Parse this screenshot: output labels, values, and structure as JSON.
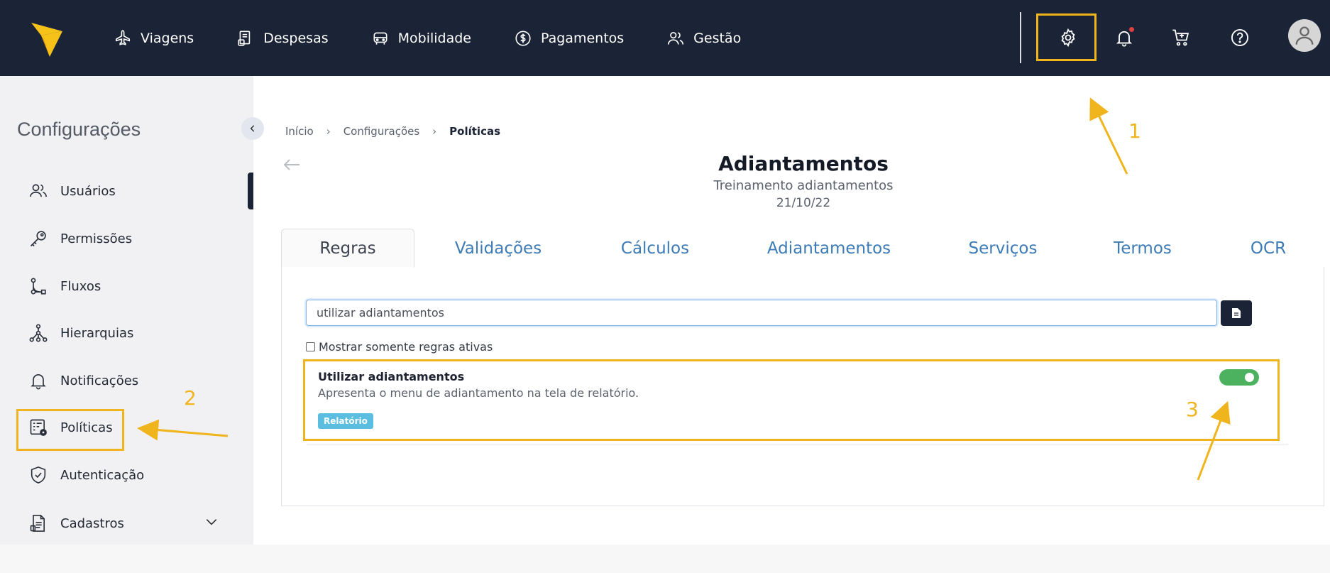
{
  "topbar": {
    "nav": [
      {
        "label": "Viagens",
        "icon": "airplane-icon"
      },
      {
        "label": "Despesas",
        "icon": "receipt-icon"
      },
      {
        "label": "Mobilidade",
        "icon": "car-icon"
      },
      {
        "label": "Pagamentos",
        "icon": "dollar-circle-icon"
      },
      {
        "label": "Gestão",
        "icon": "users-icon"
      }
    ],
    "icons": [
      "gear-icon",
      "bell-icon",
      "cart-icon",
      "help-icon",
      "user-avatar-icon"
    ]
  },
  "sidebar": {
    "title": "Configurações",
    "items": [
      {
        "label": "Usuários",
        "icon": "users-icon"
      },
      {
        "label": "Permissões",
        "icon": "key-icon"
      },
      {
        "label": "Fluxos",
        "icon": "flow-icon"
      },
      {
        "label": "Hierarquias",
        "icon": "hierarchy-icon"
      },
      {
        "label": "Notificações",
        "icon": "bell-icon"
      },
      {
        "label": "Políticas",
        "icon": "policy-gear-icon"
      },
      {
        "label": "Autenticação",
        "icon": "shield-check-icon"
      },
      {
        "label": "Cadastros",
        "icon": "document-list-icon"
      }
    ]
  },
  "breadcrumb": {
    "items": [
      "Início",
      "Configurações"
    ],
    "current": "Políticas"
  },
  "header": {
    "title": "Adiantamentos",
    "subtitle": "Treinamento adiantamentos",
    "date": "21/10/22"
  },
  "tabs": [
    {
      "label": "Regras",
      "active": true
    },
    {
      "label": "Validações"
    },
    {
      "label": "Cálculos"
    },
    {
      "label": "Adiantamentos"
    },
    {
      "label": "Serviços"
    },
    {
      "label": "Termos"
    },
    {
      "label": "OCR"
    }
  ],
  "search": {
    "value": "utilizar adiantamentos"
  },
  "filter": {
    "label": "Mostrar somente regras ativas",
    "checked": false
  },
  "rule": {
    "title": "Utilizar adiantamentos",
    "description": "Apresenta o menu de adiantamento na tela de relatório.",
    "tag": "Relatório",
    "enabled": true
  },
  "annotations": {
    "n1": "1",
    "n2": "2",
    "n3": "3"
  },
  "colors": {
    "navbar": "#1b2336",
    "highlight": "#f0b41c",
    "tab_link": "#3d7bb6",
    "toggle_on": "#4cb260",
    "tag": "#5bbde0"
  }
}
